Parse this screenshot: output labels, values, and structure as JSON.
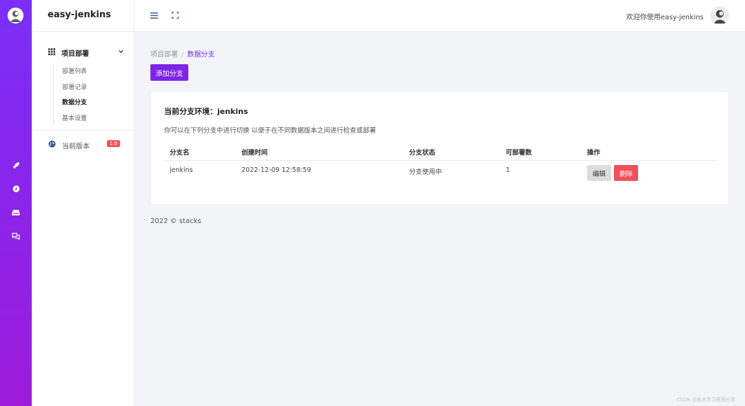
{
  "app": {
    "title": "easy-jenkins"
  },
  "rail": {
    "icons": [
      "logo-avatar-icon",
      "rocket-icon",
      "compass-icon",
      "inbox-icon",
      "chat-icon"
    ]
  },
  "sidebar": {
    "group": {
      "icon": "grid-icon",
      "label": "项目部署"
    },
    "items": [
      {
        "label": "部署列表",
        "active": false
      },
      {
        "label": "部署记录",
        "active": false
      },
      {
        "label": "数据分支",
        "active": true
      },
      {
        "label": "基本设置",
        "active": false
      }
    ],
    "version": {
      "icon": "globe-icon",
      "label": "当前版本",
      "badge": "1.0"
    }
  },
  "topbar": {
    "welcome": "欢迎你使用easy-jenkins",
    "icons": [
      "menu-icon",
      "fullscreen-icon"
    ]
  },
  "breadcrumb": {
    "parent": "项目部署",
    "separator": "/",
    "current": "数据分支"
  },
  "actions": {
    "add_label": "添加分支"
  },
  "card": {
    "title": "当前分支环境：jenkins",
    "description": "你可以在下列分支中进行切换 以便于在不同数据版本之间进行检查或部署",
    "table": {
      "headers": [
        "分支名",
        "创建时间",
        "分支状态",
        "可部署数",
        "操作"
      ],
      "rows": [
        {
          "name": "jenkins",
          "created": "2022-12-09 12:58:59",
          "status": "分支使用中",
          "count": "1",
          "edit": "编辑",
          "delete": "删除"
        }
      ]
    }
  },
  "footer": {
    "text": "2022 © stacks"
  },
  "watermark": {
    "text": "CSDN @技术学习资源分享"
  },
  "colors": {
    "accent": "#7d25e8",
    "rail_top": "#7b2ff7",
    "danger": "#f0505a",
    "background": "#f3f4f7"
  }
}
